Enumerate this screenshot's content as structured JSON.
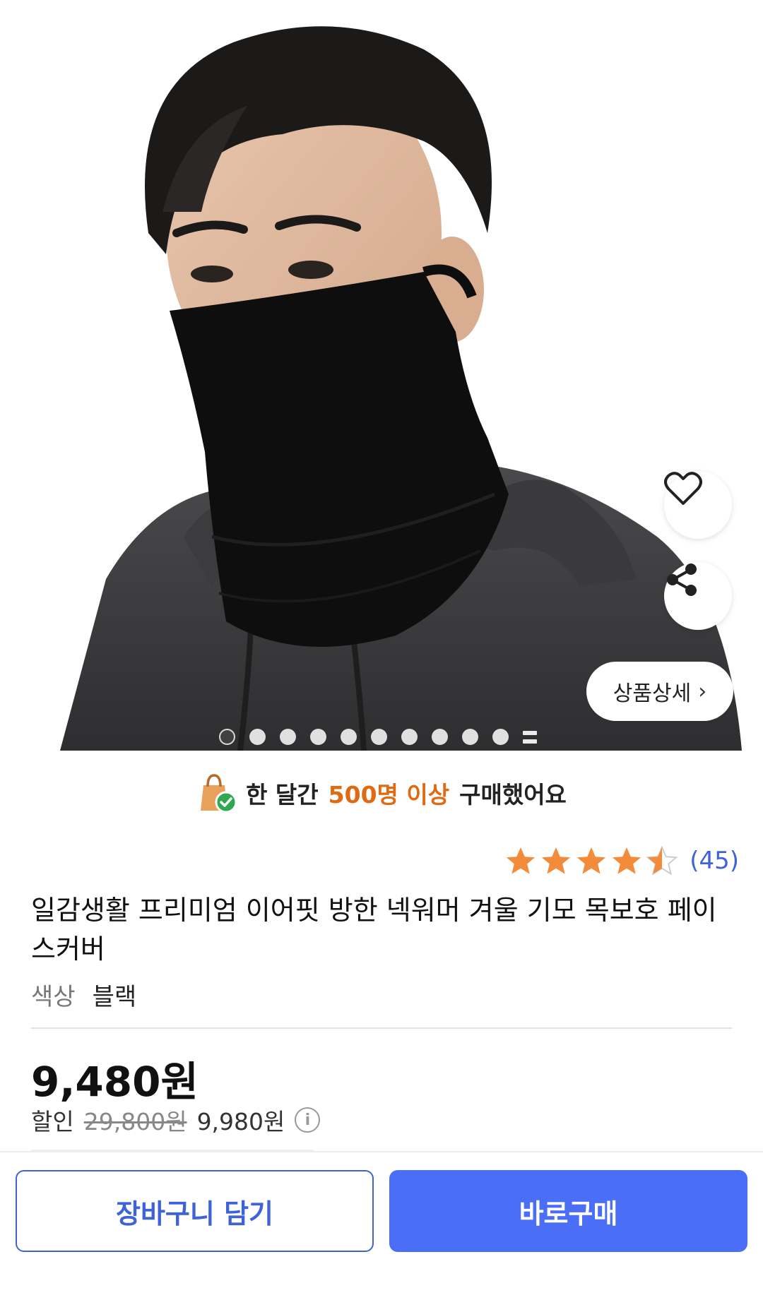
{
  "product_image": {
    "icons": {
      "wish": "heart-icon",
      "share": "share-icon"
    },
    "detail_button_label": "상품상세",
    "detail_chevron": "›",
    "carousel_total": 10,
    "carousel_active": 1
  },
  "banner": {
    "icon": "shopping-bag-check-icon",
    "prefix": "한 달간",
    "highlight": "500명 이상",
    "suffix": "구매했어요",
    "highlight_color": "#e06a12"
  },
  "rating": {
    "stars": 4.5,
    "max": 5,
    "count_label": "(45)",
    "star_color": "#f28c3a"
  },
  "product": {
    "title": "일감생활 프리미엄 이어핏 방한 넥워머 겨울 기모 목보호 페이스커버",
    "option_label": "색상",
    "option_value": "블랙"
  },
  "pricing": {
    "price": "9,480원",
    "discount_label": "할인",
    "original_price": "29,800원",
    "compare_price": "9,980원",
    "info_icon": "i"
  },
  "actions": {
    "cart_label": "장바구니 담기",
    "buy_label": "바로구매",
    "accent": "#4a6ef5"
  }
}
